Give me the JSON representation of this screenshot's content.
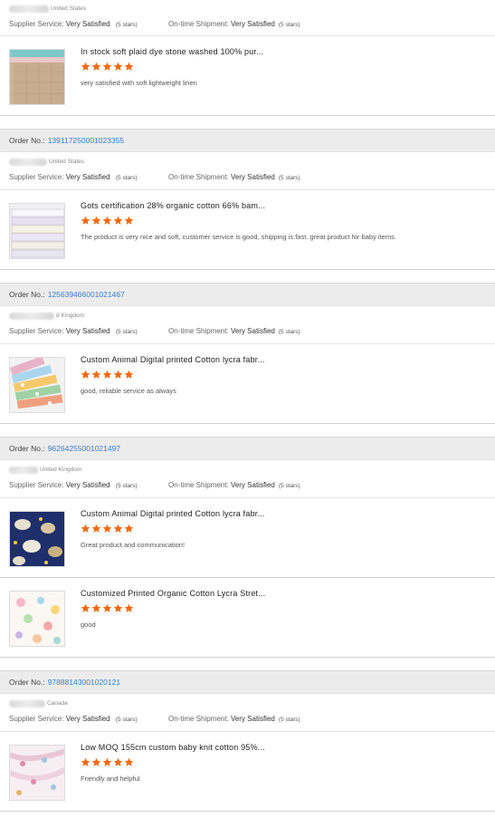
{
  "labels": {
    "order_no": "Order No.:",
    "supplier_service": "Supplier Service:",
    "ontime_shipment": "On-time Shipment:"
  },
  "colors": {
    "star": "#f26a10",
    "order_link": "#3a7ec8",
    "header_bg": "#ececec"
  },
  "orders": [
    {
      "order_no": "",
      "buyer_country": "United States",
      "supplier_service": "Very Satisfied",
      "supplier_stars": "(5 stars)",
      "ontime_shipment": "Very Satisfied",
      "ontime_stars": "(5 stars)",
      "products": [
        {
          "title": "In stock soft plaid dye stone washed 100% pur...",
          "rating": 5,
          "review": "very satisfied with soft lightweight linen",
          "thumb": "linen-folded"
        }
      ]
    },
    {
      "order_no": "139117250001023355",
      "buyer_country": "United States",
      "supplier_service": "Very Satisfied",
      "supplier_stars": "(5 stars)",
      "ontime_shipment": "Very Satisfied",
      "ontime_stars": "(5 stars)",
      "products": [
        {
          "title": "Gots certification 28% organic cotton 66% bam...",
          "rating": 5,
          "review": "The product is very nice and soft, customer service is good, shipping is fast. great product for baby items.",
          "thumb": "white-cotton-stack"
        }
      ]
    },
    {
      "order_no": "125639466001021467",
      "buyer_country": "d Kingdom",
      "supplier_service": "Very Satisfied",
      "supplier_stars": "(5 stars)",
      "ontime_shipment": "Very Satisfied",
      "ontime_stars": "(5 stars)",
      "products": [
        {
          "title": "Custom Animal Digital printed Cotton lycra fabr...",
          "rating": 5,
          "review": "good, reliable service as always",
          "thumb": "printed-fabric-rolls"
        }
      ]
    },
    {
      "order_no": "96264255001021497",
      "buyer_country": "United Kingdom",
      "supplier_service": "Very Satisfied",
      "supplier_stars": "(5 stars)",
      "ontime_shipment": "Very Satisfied",
      "ontime_stars": "(5 stars)",
      "products": [
        {
          "title": "Custom Animal Digital printed Cotton lycra fabr...",
          "rating": 5,
          "review": "Great product and communication!",
          "thumb": "navy-animal-print"
        },
        {
          "title": "Customized Printed Organic Cotton Lycra Stret...",
          "rating": 5,
          "review": "good",
          "thumb": "pastel-animal-print"
        }
      ]
    },
    {
      "order_no": "97888143001020121",
      "buyer_country": "Canada",
      "supplier_service": "Very Satisfied",
      "supplier_stars": "(5 stars)",
      "ontime_shipment": "Very Satisfied",
      "ontime_stars": "(5 stars)",
      "products": [
        {
          "title": "Low MOQ 155cm custom baby knit cotton 95%...",
          "rating": 5,
          "review": "Friendly and helpful",
          "thumb": "pink-knit-print"
        }
      ]
    }
  ]
}
